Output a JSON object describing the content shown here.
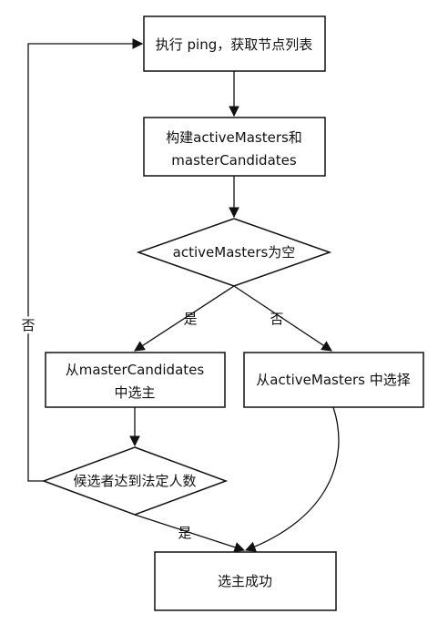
{
  "diagram": {
    "nodes": {
      "ping": "执行 ping，获取节点列表",
      "build_line1": "构建activeMasters和",
      "build_line2": "masterCandidates",
      "check_empty": "activeMasters为空",
      "from_candidates_line1": "从masterCandidates",
      "from_candidates_line2": "中选主",
      "from_active": "从activeMasters 中选择",
      "quorum": "候选者达到法定人数",
      "success": "选主成功"
    },
    "edge_labels": {
      "empty_yes": "是",
      "empty_no": "否",
      "quorum_no": "否",
      "quorum_yes": "是"
    },
    "colors": {
      "stroke": "#111111",
      "background": "#ffffff"
    }
  }
}
